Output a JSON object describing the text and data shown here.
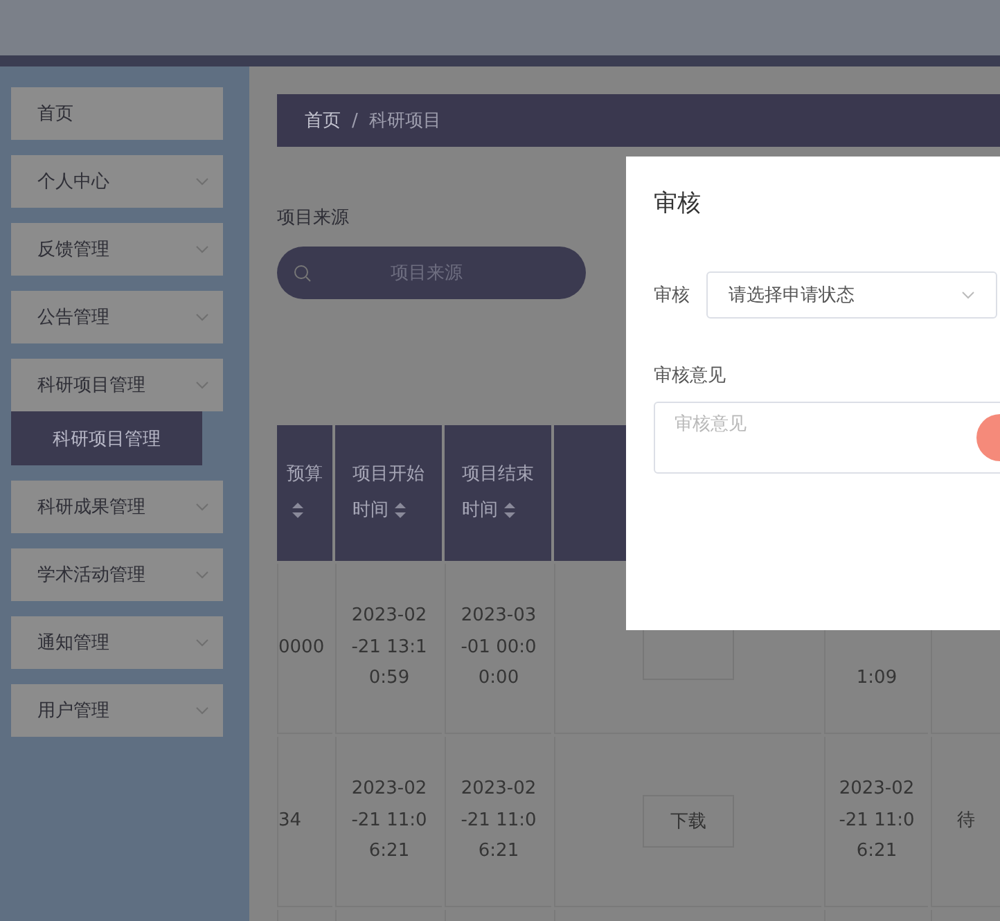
{
  "sidebar": {
    "items": [
      {
        "label": "首页",
        "kind": "link"
      },
      {
        "label": "个人中心",
        "kind": "menu"
      },
      {
        "label": "反馈管理",
        "kind": "menu"
      },
      {
        "label": "公告管理",
        "kind": "menu"
      },
      {
        "label": "科研项目管理",
        "kind": "menu",
        "children": [
          {
            "label": "科研项目管理",
            "selected": true
          }
        ]
      },
      {
        "label": "科研成果管理",
        "kind": "menu"
      },
      {
        "label": "学术活动管理",
        "kind": "menu"
      },
      {
        "label": "通知管理",
        "kind": "menu"
      },
      {
        "label": "用户管理",
        "kind": "menu"
      }
    ]
  },
  "breadcrumb": [
    "首页",
    "/",
    "科研项目"
  ],
  "search": {
    "label": "项目来源",
    "placeholder": "项目来源"
  },
  "table": {
    "columns": [
      {
        "label": "预算"
      },
      {
        "label": "项目开始时间"
      },
      {
        "label": "项目结束时间"
      }
    ],
    "rows": [
      {
        "budget": "0000",
        "start": "2023-02-21 13:10:59",
        "end": "2023-03-01 00:00:00",
        "time": "1:09"
      },
      {
        "budget": "34",
        "start": "2023-02-21 11:06:21",
        "end": "2023-02-21 11:06:21",
        "file_button": "下载",
        "time": "2023-02-21 11:06:21",
        "status": "待"
      }
    ]
  },
  "dialog": {
    "title": "审核",
    "status_label": "审核",
    "status_placeholder": "请选择申请状态",
    "opinion_label": "审核意见",
    "opinion_placeholder": "审核意见"
  }
}
